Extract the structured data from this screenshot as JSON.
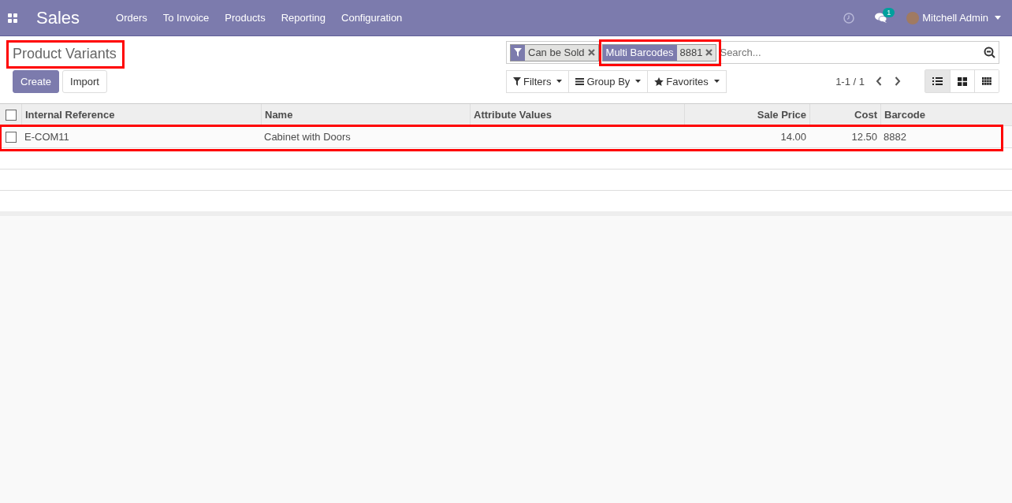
{
  "navbar": {
    "app": "Sales",
    "menu": [
      "Orders",
      "To Invoice",
      "Products",
      "Reporting",
      "Configuration"
    ],
    "messages_count": "1",
    "user": "Mitchell Admin"
  },
  "page_title": {
    "text": "Product Variants",
    "highlighted": true
  },
  "buttons": [
    {
      "label": "Create",
      "kind": "primary"
    },
    {
      "label": "Import",
      "kind": "secondary"
    }
  ],
  "search": {
    "facets": [
      {
        "kind": "filter",
        "values": [
          "Can be Sold"
        ],
        "highlighted": false
      },
      {
        "kind": "field",
        "label": "Multi Barcodes",
        "values": [
          "8881"
        ],
        "highlighted": true
      }
    ],
    "placeholder": "Search..."
  },
  "search_options": [
    "Filters",
    "Group By",
    "Favorites"
  ],
  "pager": "1-1 / 1",
  "views": [
    {
      "kind": "list",
      "selected": true
    },
    {
      "kind": "kanban",
      "selected": false
    },
    {
      "kind": "grid",
      "selected": false
    }
  ],
  "table": {
    "select_all_checked": false,
    "columns": [
      {
        "label": "Internal Reference",
        "kind": "text"
      },
      {
        "label": "Name",
        "kind": "text"
      },
      {
        "label": "Attribute Values",
        "kind": "text"
      },
      {
        "label": "Sale Price",
        "kind": "number"
      },
      {
        "label": "Cost",
        "kind": "number"
      },
      {
        "label": "Barcode",
        "kind": "text"
      }
    ],
    "rows": [
      {
        "checked": false,
        "highlighted": true,
        "cells": [
          "E-COM11",
          "Cabinet with Doors",
          "",
          "14.00",
          "12.50",
          "8882"
        ]
      }
    ]
  }
}
